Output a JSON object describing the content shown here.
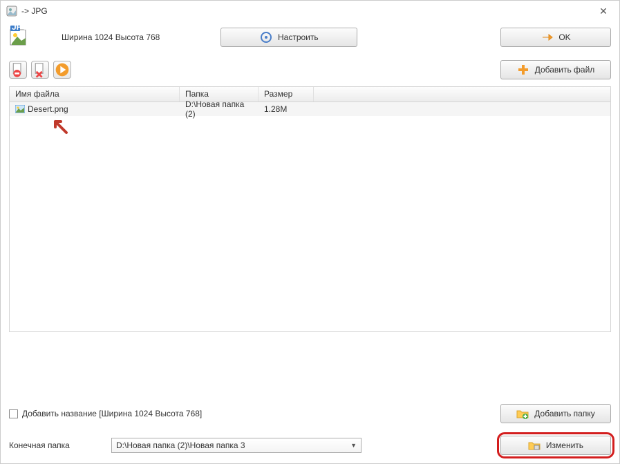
{
  "window": {
    "title": " -> JPG"
  },
  "top": {
    "dimensions": "Ширина 1024 Высота 768",
    "configure": "Настроить",
    "ok": "OK",
    "add_file": "Добавить файл"
  },
  "table": {
    "headers": {
      "name": "Имя файла",
      "folder": "Папка",
      "size": "Размер"
    },
    "rows": [
      {
        "name": "Desert.png",
        "folder": "D:\\Новая папка (2)",
        "size": "1.28M"
      }
    ]
  },
  "bottom": {
    "add_title_label": "Добавить название [Ширина 1024 Высота 768]",
    "dest_folder_label": "Конечная папка",
    "dest_path": "D:\\Новая папка (2)\\Новая папка 3",
    "add_folder": "Добавить папку",
    "change": "Изменить"
  }
}
